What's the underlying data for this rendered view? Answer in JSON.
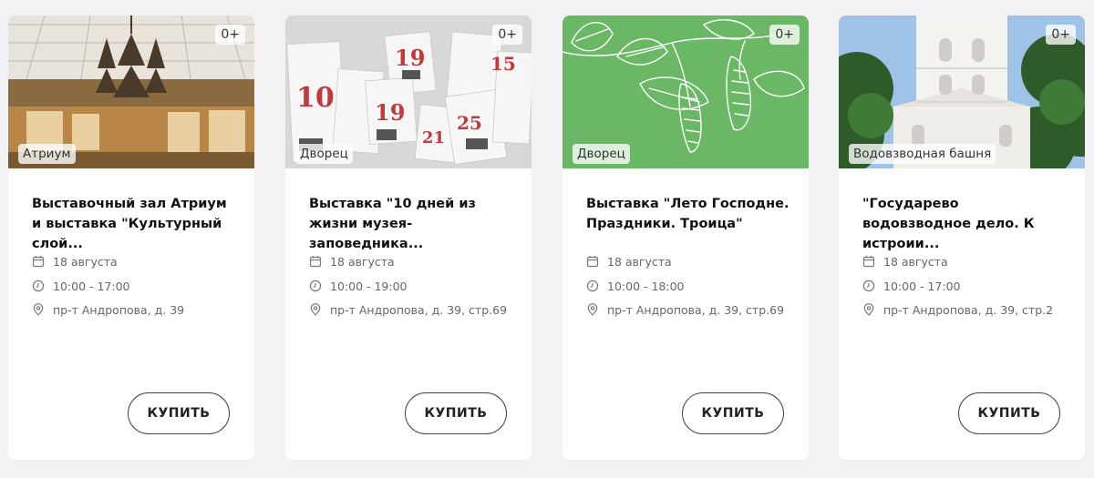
{
  "buy_label": "КУПИТЬ",
  "colors": {
    "card_bg": "#ffffff",
    "page_bg": "#f2f2f4",
    "green_thumb": "#6ab866",
    "meta_text": "#666666"
  },
  "cards": [
    {
      "age": "0+",
      "place": "Атриум",
      "title": "Выставочный зал Атриум и выставка \"Культурный слой...",
      "date": "18 августа",
      "time": "10:00 - 17:00",
      "address": "пр-т Андропова, д. 39"
    },
    {
      "age": "0+",
      "place": "Дворец",
      "title": "Выставка \"10 дней из жизни музея-заповедника...",
      "date": "18 августа",
      "time": "10:00 - 19:00",
      "address": "пр-т Андропова, д. 39, стр.69"
    },
    {
      "age": "0+",
      "place": "Дворец",
      "title": "Выставка \"Лето Господне. Праздники. Троица\"",
      "date": "18 августа",
      "time": "10:00 - 18:00",
      "address": "пр-т Андропова, д. 39, стр.69"
    },
    {
      "age": "0+",
      "place": "Водовзводная башня",
      "title": "\"Государево водовзводное дело. К истроии...",
      "date": "18 августа",
      "time": "10:00 - 17:00",
      "address": "пр-т Андропова, д. 39, стр.2"
    }
  ],
  "icons": {
    "date": "calendar-icon",
    "time": "clock-icon",
    "address": "location-pin-icon"
  }
}
